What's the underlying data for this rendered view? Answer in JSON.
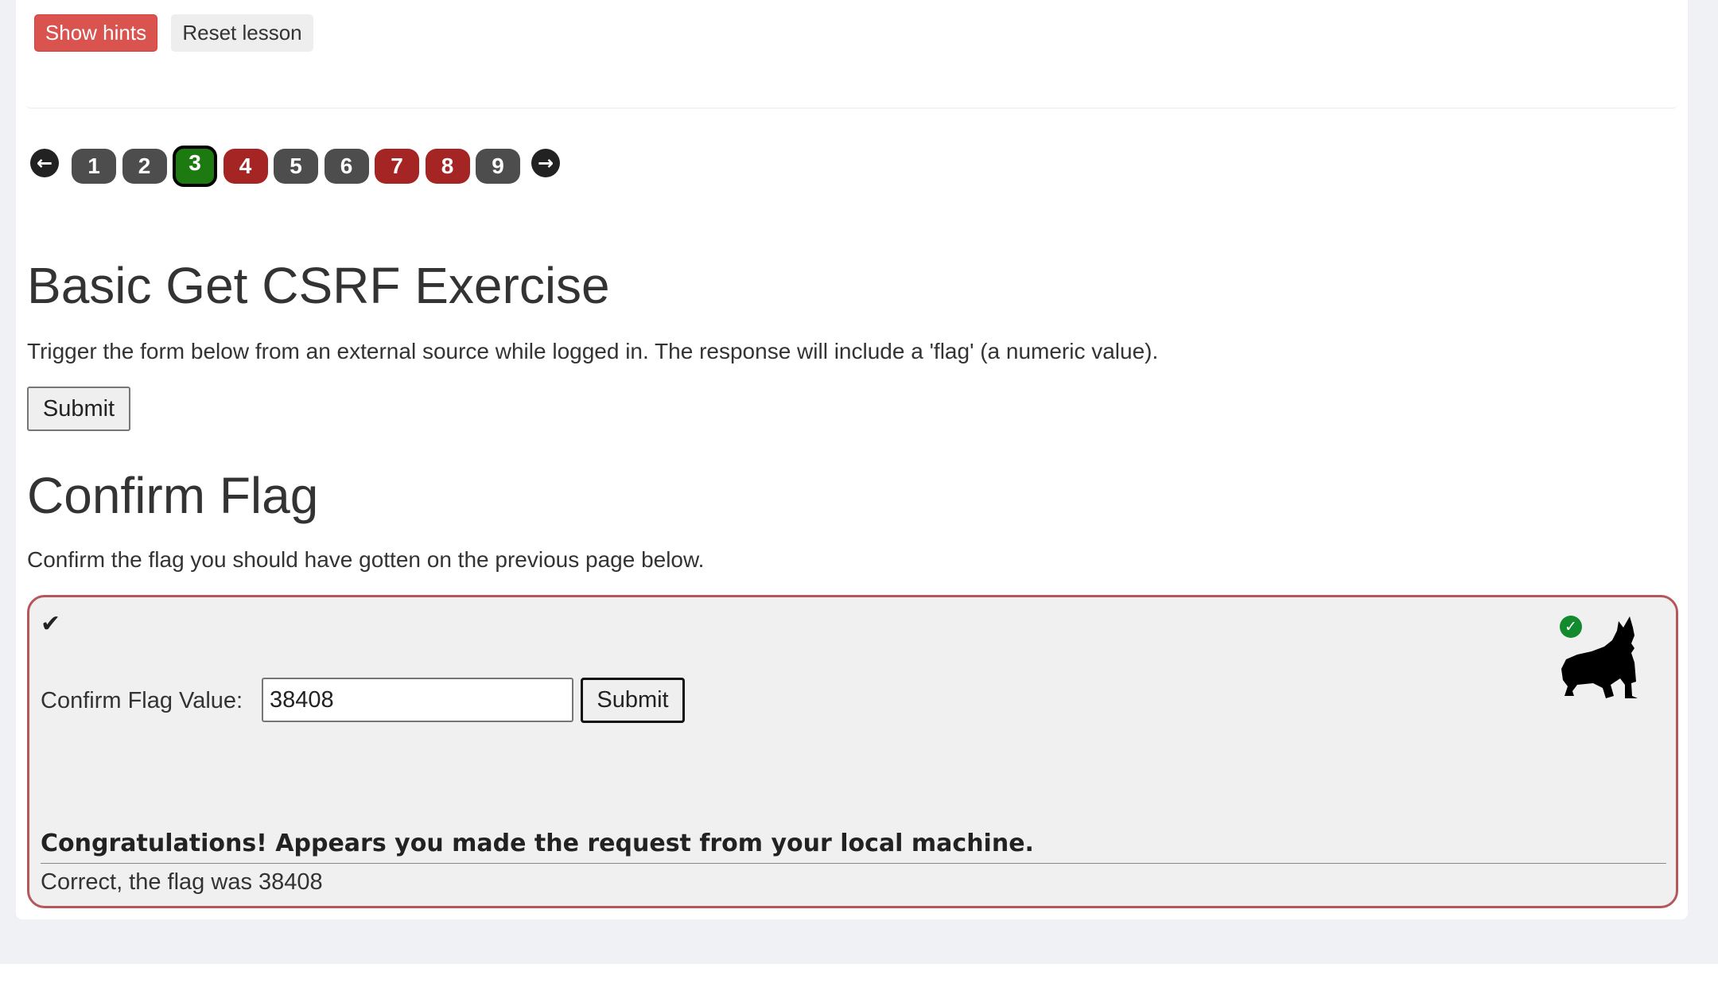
{
  "toolbar": {
    "show_hints_label": "Show hints",
    "reset_lesson_label": "Reset lesson"
  },
  "pagination": {
    "prev_icon": "arrow-left-icon",
    "next_icon": "arrow-right-icon",
    "pages": [
      {
        "label": "1",
        "state": "grey"
      },
      {
        "label": "2",
        "state": "grey"
      },
      {
        "label": "3",
        "state": "current"
      },
      {
        "label": "4",
        "state": "red"
      },
      {
        "label": "5",
        "state": "grey"
      },
      {
        "label": "6",
        "state": "grey"
      },
      {
        "label": "7",
        "state": "red"
      },
      {
        "label": "8",
        "state": "red"
      },
      {
        "label": "9",
        "state": "grey"
      }
    ]
  },
  "exercise": {
    "title": "Basic Get CSRF Exercise",
    "description": "Trigger the form below from an external source while logged in. The response will include a 'flag' (a numeric value).",
    "submit_label": "Submit"
  },
  "confirm": {
    "title": "Confirm Flag",
    "description": "Confirm the flag you should have gotten on the previous page below.",
    "flag_label": "Confirm Flag Value:",
    "flag_value": "38408",
    "submit_label": "Submit",
    "feedback": "Congratulations! Appears you made the request from your local machine.",
    "output": "Correct, the flag was 38408"
  },
  "colors": {
    "danger": "#d9534f",
    "page_red": "#a52424",
    "page_grey": "#4d4d4d",
    "page_current": "#1d7a10",
    "box_border": "#b5585c",
    "success": "#138a2e"
  }
}
